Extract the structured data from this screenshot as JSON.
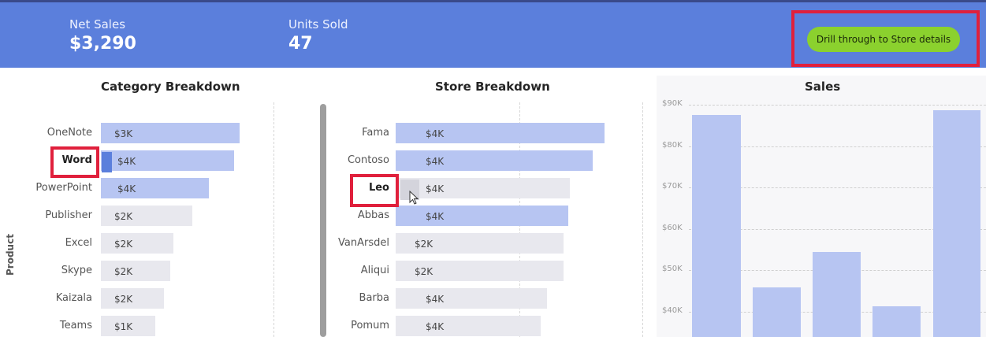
{
  "kpis": {
    "net_sales_label": "Net Sales",
    "net_sales_value": "$3,290",
    "units_sold_label": "Units Sold",
    "units_sold_value": "47"
  },
  "drill_button": {
    "label": "Drill through to Store details"
  },
  "category_breakdown": {
    "title": "Category Breakdown",
    "axis_title": "Product",
    "rows": [
      {
        "label": "OneNote",
        "value": "$3K"
      },
      {
        "label": "Word",
        "value": "$4K"
      },
      {
        "label": "PowerPoint",
        "value": "$4K"
      },
      {
        "label": "Publisher",
        "value": "$2K"
      },
      {
        "label": "Excel",
        "value": "$2K"
      },
      {
        "label": "Skype",
        "value": "$2K"
      },
      {
        "label": "Kaizala",
        "value": "$2K"
      },
      {
        "label": "Teams",
        "value": "$1K"
      }
    ]
  },
  "store_breakdown": {
    "title": "Store Breakdown",
    "rows": [
      {
        "label": "Fama",
        "value": "$4K"
      },
      {
        "label": "Contoso",
        "value": "$4K"
      },
      {
        "label": "Leo",
        "value": "$4K"
      },
      {
        "label": "Abbas",
        "value": "$4K"
      },
      {
        "label": "VanArsdel",
        "value": "$2K"
      },
      {
        "label": "Aliqui",
        "value": "$2K"
      },
      {
        "label": "Barba",
        "value": "$4K"
      },
      {
        "label": "Pomum",
        "value": "$4K"
      }
    ]
  },
  "sales_chart": {
    "title": "Sales",
    "ticks": [
      "$90K",
      "$80K",
      "$70K",
      "$60K",
      "$50K",
      "$40K"
    ]
  },
  "colors": {
    "header": "#5b7fdc",
    "selected_bar": "#b7c5f2",
    "unselected_bar": "#e8e8ee",
    "highlight_box": "#e0203c",
    "drill_button": "#8bd12e"
  }
}
